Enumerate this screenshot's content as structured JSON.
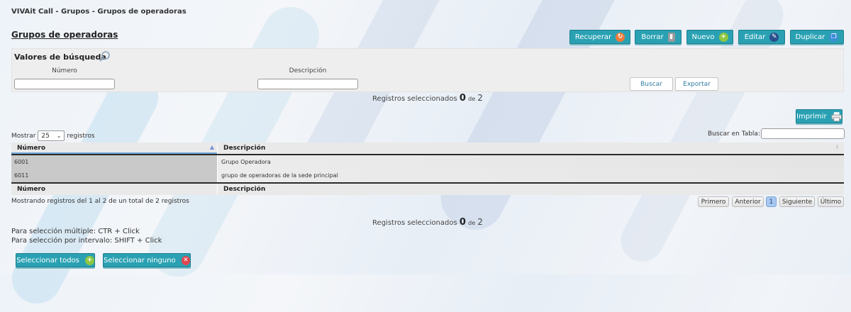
{
  "breadcrumb": "VIVAit Call - Grupos - Grupos de operadoras",
  "page_title": "Grupos de operadoras",
  "toolbar": {
    "recover_label": "Recuperar",
    "delete_label": "Borrar",
    "new_label": "Nuevo",
    "edit_label": "Editar",
    "duplicate_label": "Duplicar"
  },
  "search": {
    "title": "Valores de búsqueda",
    "number_label": "Número",
    "description_label": "Descripción",
    "number_value": "",
    "description_value": "",
    "search_label": "Buscar",
    "export_label": "Exportar"
  },
  "selection": {
    "prefix": "Registros seleccionados",
    "selected": "0",
    "of": "de",
    "total": "2"
  },
  "print_label": "Imprimir",
  "table_controls": {
    "show_label": "Mostrar",
    "page_size": "25",
    "records_label": "registros",
    "search_table_label": "Buscar en Tabla:",
    "search_table_value": ""
  },
  "table": {
    "columns": [
      "Número",
      "Descripción"
    ],
    "rows": [
      {
        "number": "6001",
        "description": "Grupo Operadora"
      },
      {
        "number": "6011",
        "description": "grupo de operadoras de la sede principal"
      }
    ],
    "info": "Mostrando registros del 1 al 2 de un total de 2 registros"
  },
  "pagination": {
    "first": "Primero",
    "prev": "Anterior",
    "current": "1",
    "next": "Siguiente",
    "last": "Último"
  },
  "help": {
    "multi": "Para selección múltiple: CTR + Click",
    "range": "Para selección por intervalo: SHIFT + Click"
  },
  "bottom_buttons": {
    "select_all": "Seleccionar todos",
    "select_none": "Seleccionar ninguno"
  },
  "colors": {
    "accent": "#2aa1b3",
    "accent_border": "#1c7f8e",
    "recover_icon": "#f07a3a",
    "delete_icon": "#9a9a9a",
    "new_icon": "#8dc641",
    "edit_icon": "#2b4f8c",
    "duplicate_icon": "#3a8fd6",
    "none_icon": "#e0454f"
  },
  "icons": {
    "recover": "recover-icon",
    "delete": "trash-icon",
    "new": "plus-icon",
    "edit": "pencil-icon",
    "duplicate": "duplicate-icon",
    "search": "magnifier-icon",
    "print": "printer-icon",
    "select_all": "check-all-icon",
    "select_none": "close-icon",
    "sort": "sort-arrow-icon"
  }
}
